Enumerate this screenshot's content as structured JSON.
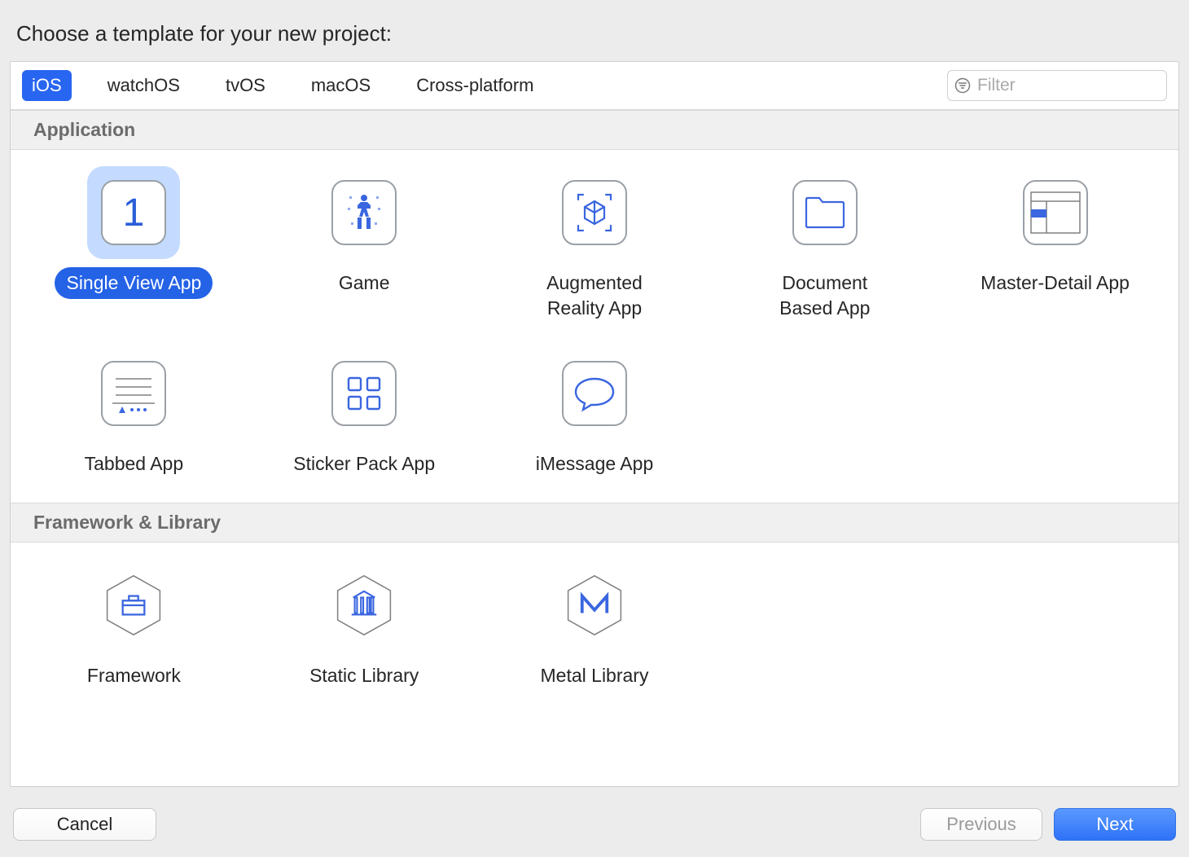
{
  "header": {
    "title": "Choose a template for your new project:"
  },
  "toolbar": {
    "platforms": [
      "iOS",
      "watchOS",
      "tvOS",
      "macOS",
      "Cross-platform"
    ],
    "active_platform_index": 0,
    "filter_placeholder": "Filter",
    "filter_value": ""
  },
  "sections": [
    {
      "title": "Application",
      "templates": [
        {
          "label": "Single View App",
          "icon": "single-view",
          "selected": true
        },
        {
          "label": "Game",
          "icon": "game"
        },
        {
          "label": "Augmented\nReality App",
          "icon": "ar"
        },
        {
          "label": "Document\nBased App",
          "icon": "document"
        },
        {
          "label": "Master-Detail App",
          "icon": "master-detail"
        },
        {
          "label": "Tabbed App",
          "icon": "tabbed"
        },
        {
          "label": "Sticker Pack App",
          "icon": "sticker"
        },
        {
          "label": "iMessage App",
          "icon": "imessage"
        }
      ]
    },
    {
      "title": "Framework & Library",
      "templates": [
        {
          "label": "Framework",
          "icon": "framework"
        },
        {
          "label": "Static Library",
          "icon": "static-library"
        },
        {
          "label": "Metal Library",
          "icon": "metal-library"
        }
      ]
    }
  ],
  "footer": {
    "cancel": "Cancel",
    "previous": "Previous",
    "next": "Next",
    "previous_enabled": false
  }
}
